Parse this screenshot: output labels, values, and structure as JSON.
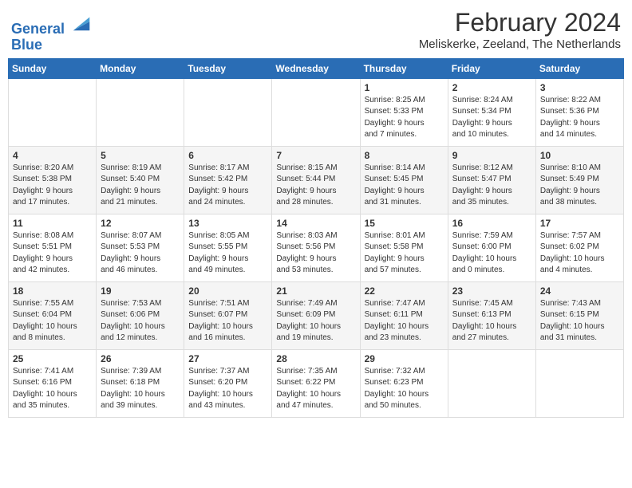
{
  "header": {
    "logo_line1": "General",
    "logo_line2": "Blue",
    "month": "February 2024",
    "location": "Meliskerke, Zeeland, The Netherlands"
  },
  "columns": [
    "Sunday",
    "Monday",
    "Tuesday",
    "Wednesday",
    "Thursday",
    "Friday",
    "Saturday"
  ],
  "weeks": [
    {
      "days": [
        {
          "num": "",
          "info": ""
        },
        {
          "num": "",
          "info": ""
        },
        {
          "num": "",
          "info": ""
        },
        {
          "num": "",
          "info": ""
        },
        {
          "num": "1",
          "info": "Sunrise: 8:25 AM\nSunset: 5:33 PM\nDaylight: 9 hours\nand 7 minutes."
        },
        {
          "num": "2",
          "info": "Sunrise: 8:24 AM\nSunset: 5:34 PM\nDaylight: 9 hours\nand 10 minutes."
        },
        {
          "num": "3",
          "info": "Sunrise: 8:22 AM\nSunset: 5:36 PM\nDaylight: 9 hours\nand 14 minutes."
        }
      ]
    },
    {
      "days": [
        {
          "num": "4",
          "info": "Sunrise: 8:20 AM\nSunset: 5:38 PM\nDaylight: 9 hours\nand 17 minutes."
        },
        {
          "num": "5",
          "info": "Sunrise: 8:19 AM\nSunset: 5:40 PM\nDaylight: 9 hours\nand 21 minutes."
        },
        {
          "num": "6",
          "info": "Sunrise: 8:17 AM\nSunset: 5:42 PM\nDaylight: 9 hours\nand 24 minutes."
        },
        {
          "num": "7",
          "info": "Sunrise: 8:15 AM\nSunset: 5:44 PM\nDaylight: 9 hours\nand 28 minutes."
        },
        {
          "num": "8",
          "info": "Sunrise: 8:14 AM\nSunset: 5:45 PM\nDaylight: 9 hours\nand 31 minutes."
        },
        {
          "num": "9",
          "info": "Sunrise: 8:12 AM\nSunset: 5:47 PM\nDaylight: 9 hours\nand 35 minutes."
        },
        {
          "num": "10",
          "info": "Sunrise: 8:10 AM\nSunset: 5:49 PM\nDaylight: 9 hours\nand 38 minutes."
        }
      ]
    },
    {
      "days": [
        {
          "num": "11",
          "info": "Sunrise: 8:08 AM\nSunset: 5:51 PM\nDaylight: 9 hours\nand 42 minutes."
        },
        {
          "num": "12",
          "info": "Sunrise: 8:07 AM\nSunset: 5:53 PM\nDaylight: 9 hours\nand 46 minutes."
        },
        {
          "num": "13",
          "info": "Sunrise: 8:05 AM\nSunset: 5:55 PM\nDaylight: 9 hours\nand 49 minutes."
        },
        {
          "num": "14",
          "info": "Sunrise: 8:03 AM\nSunset: 5:56 PM\nDaylight: 9 hours\nand 53 minutes."
        },
        {
          "num": "15",
          "info": "Sunrise: 8:01 AM\nSunset: 5:58 PM\nDaylight: 9 hours\nand 57 minutes."
        },
        {
          "num": "16",
          "info": "Sunrise: 7:59 AM\nSunset: 6:00 PM\nDaylight: 10 hours\nand 0 minutes."
        },
        {
          "num": "17",
          "info": "Sunrise: 7:57 AM\nSunset: 6:02 PM\nDaylight: 10 hours\nand 4 minutes."
        }
      ]
    },
    {
      "days": [
        {
          "num": "18",
          "info": "Sunrise: 7:55 AM\nSunset: 6:04 PM\nDaylight: 10 hours\nand 8 minutes."
        },
        {
          "num": "19",
          "info": "Sunrise: 7:53 AM\nSunset: 6:06 PM\nDaylight: 10 hours\nand 12 minutes."
        },
        {
          "num": "20",
          "info": "Sunrise: 7:51 AM\nSunset: 6:07 PM\nDaylight: 10 hours\nand 16 minutes."
        },
        {
          "num": "21",
          "info": "Sunrise: 7:49 AM\nSunset: 6:09 PM\nDaylight: 10 hours\nand 19 minutes."
        },
        {
          "num": "22",
          "info": "Sunrise: 7:47 AM\nSunset: 6:11 PM\nDaylight: 10 hours\nand 23 minutes."
        },
        {
          "num": "23",
          "info": "Sunrise: 7:45 AM\nSunset: 6:13 PM\nDaylight: 10 hours\nand 27 minutes."
        },
        {
          "num": "24",
          "info": "Sunrise: 7:43 AM\nSunset: 6:15 PM\nDaylight: 10 hours\nand 31 minutes."
        }
      ]
    },
    {
      "days": [
        {
          "num": "25",
          "info": "Sunrise: 7:41 AM\nSunset: 6:16 PM\nDaylight: 10 hours\nand 35 minutes."
        },
        {
          "num": "26",
          "info": "Sunrise: 7:39 AM\nSunset: 6:18 PM\nDaylight: 10 hours\nand 39 minutes."
        },
        {
          "num": "27",
          "info": "Sunrise: 7:37 AM\nSunset: 6:20 PM\nDaylight: 10 hours\nand 43 minutes."
        },
        {
          "num": "28",
          "info": "Sunrise: 7:35 AM\nSunset: 6:22 PM\nDaylight: 10 hours\nand 47 minutes."
        },
        {
          "num": "29",
          "info": "Sunrise: 7:32 AM\nSunset: 6:23 PM\nDaylight: 10 hours\nand 50 minutes."
        },
        {
          "num": "",
          "info": ""
        },
        {
          "num": "",
          "info": ""
        }
      ]
    }
  ]
}
